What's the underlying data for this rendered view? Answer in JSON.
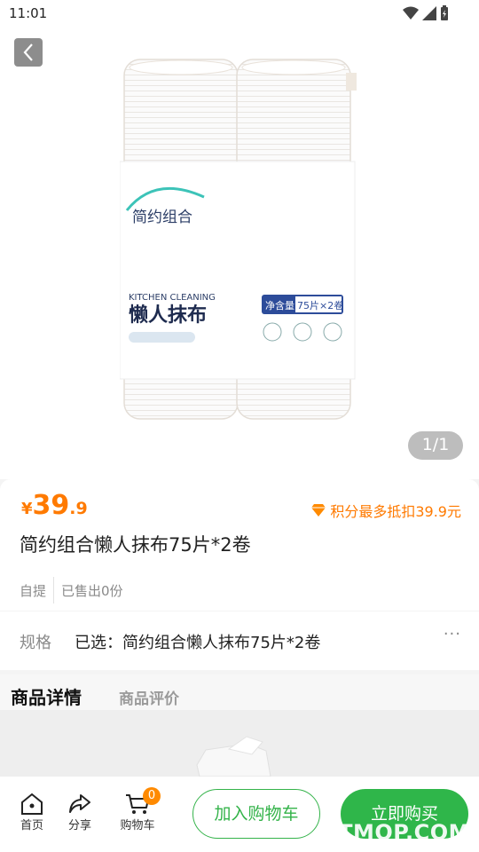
{
  "status_bar": {
    "time": "11:01"
  },
  "gallery": {
    "counter": "1/1"
  },
  "product": {
    "price_symbol": "¥",
    "price_int": "39",
    "price_dec": ".9",
    "points_text": "积分最多抵扣39.9元",
    "title": "简约组合懒人抹布75片*2卷",
    "tag_pickup": "自提",
    "tag_sold": "已售出0份",
    "package": {
      "brand": "简约组合",
      "subtitle": "KITCHEN CLEANING",
      "name": "懒人抹布",
      "net_label": "净含量",
      "net_value": "75片×2卷"
    }
  },
  "spec": {
    "label": "规格",
    "value": "已选：简约组合懒人抹布75片*2卷",
    "more": "···"
  },
  "tabs": {
    "details": "商品详情",
    "reviews": "商品评价"
  },
  "bottom_bar": {
    "home": "首页",
    "share": "分享",
    "cart": "购物车",
    "cart_count": "0",
    "add_to_cart": "加入购物车",
    "buy_now": "立即购买"
  },
  "watermark": "ITMOP.COM",
  "colors": {
    "price": "#ff7a00",
    "primary": "#2fb64a"
  }
}
